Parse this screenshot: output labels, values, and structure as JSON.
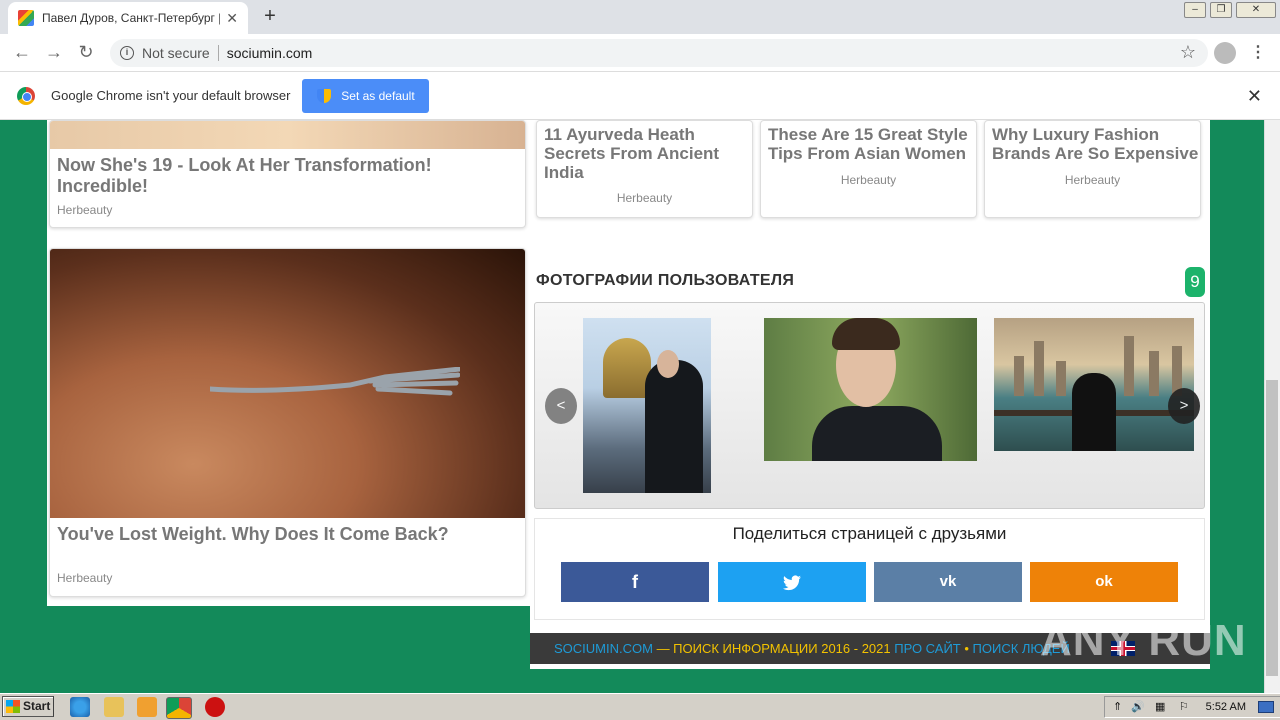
{
  "browser": {
    "tab_title": "Павел Дуров, Санкт-Петербург | С",
    "tab_close": "✕",
    "new_tab": "+",
    "security_label": "Not secure",
    "url": "sociumin.com",
    "star_icon": "☆",
    "menu_icon": "⋮",
    "back": "←",
    "forward": "→",
    "reload": "↻",
    "win_min": "–",
    "win_max": "❐",
    "win_close": "✕"
  },
  "infobar": {
    "message": "Google Chrome isn't your default browser",
    "button": "Set as default",
    "close": "✕"
  },
  "ads": [
    {
      "title": "Now She's 19 - Look At Her Transformation! Incredible!",
      "source": "Herbeauty"
    },
    {
      "title": "You've Lost Weight. Why Does It Come Back?",
      "source": "Herbeauty"
    },
    {
      "title": "11 Ayurveda Heath Secrets From Ancient India",
      "source": "Herbeauty"
    },
    {
      "title": "These Are 15 Great Style Tips From Asian Women",
      "source": "Herbeauty"
    },
    {
      "title": "Why Luxury Fashion Brands Are So Expensive",
      "source": "Herbeauty"
    }
  ],
  "photos": {
    "title": "ФОТОГРАФИИ ПОЛЬЗОВАТЕЛЯ",
    "count": "9",
    "prev": "<",
    "next": ">"
  },
  "share": {
    "title": "Поделиться страницей с друзьями",
    "facebook": "f",
    "twitter": "🐦",
    "vk": "vk",
    "ok": "ok",
    "colors": {
      "facebook": "#3b5998",
      "twitter": "#1da1f2",
      "vk": "#5b7fa6",
      "ok": "#ee8208"
    }
  },
  "footer": {
    "site": "SOCIUMIN.COM",
    "tagline": " — ПОИСК ИНФОРМАЦИИ 2016 - 2021 ",
    "about": "ПРО САЙТ",
    "dot": " • ",
    "people": "ПОИСК ЛЮДЕЙ"
  },
  "watermark": "ANY RUN",
  "taskbar": {
    "start": "Start",
    "clock": "5:52 AM"
  }
}
